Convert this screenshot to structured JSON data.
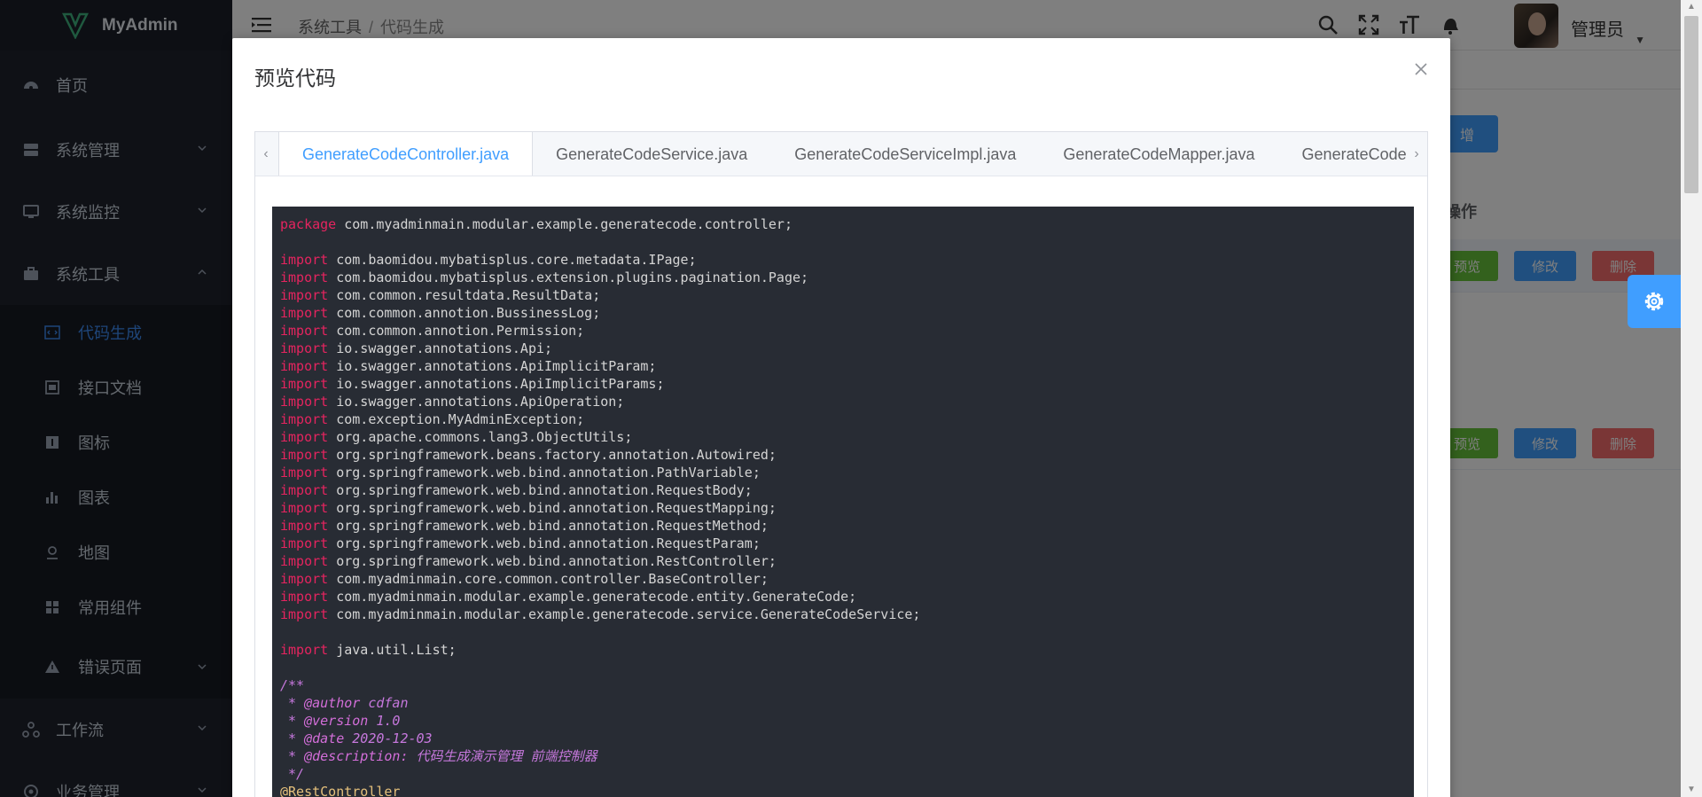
{
  "app": {
    "name": "MyAdmin"
  },
  "sidebar": {
    "items": [
      {
        "label": "首页",
        "icon": "dashboard-icon"
      },
      {
        "label": "系统管理",
        "icon": "server-icon"
      },
      {
        "label": "系统监控",
        "icon": "monitor-icon"
      },
      {
        "label": "系统工具",
        "icon": "toolbox-icon"
      }
    ],
    "sub_items": [
      {
        "label": "代码生成",
        "icon": "code-icon",
        "active": true
      },
      {
        "label": "接口文档",
        "icon": "doc-icon"
      },
      {
        "label": "图标",
        "icon": "info-icon"
      },
      {
        "label": "图表",
        "icon": "bar-chart-icon"
      },
      {
        "label": "地图",
        "icon": "map-pin-icon"
      },
      {
        "label": "常用组件",
        "icon": "grid-icon"
      },
      {
        "label": "错误页面",
        "icon": "warning-icon"
      }
    ],
    "bottom_items": [
      {
        "label": "工作流",
        "icon": "workflow-icon"
      },
      {
        "label": "业务管理",
        "icon": "business-icon"
      }
    ]
  },
  "header": {
    "breadcrumb": [
      "系统工具",
      "代码生成"
    ],
    "username": "管理员"
  },
  "background": {
    "table_header": "操作",
    "add_button": "增",
    "row_buttons": {
      "preview": "预览",
      "edit": "修改",
      "delete": "删除"
    }
  },
  "modal": {
    "title": "预览代码",
    "tabs": [
      "GenerateCodeController.java",
      "GenerateCodeService.java",
      "GenerateCodeServiceImpl.java",
      "GenerateCodeMapper.java",
      "GenerateCodeMap"
    ],
    "active_tab": 0
  },
  "code": {
    "lines": [
      [
        [
          "kw",
          "package"
        ],
        [
          "t",
          " com.myadminmain.modular.example.generatecode.controller;"
        ]
      ],
      [],
      [
        [
          "kw",
          "import"
        ],
        [
          "t",
          " com.baomidou.mybatisplus.core.metadata.IPage;"
        ]
      ],
      [
        [
          "kw",
          "import"
        ],
        [
          "t",
          " com.baomidou.mybatisplus.extension.plugins.pagination.Page;"
        ]
      ],
      [
        [
          "kw",
          "import"
        ],
        [
          "t",
          " com.common.resultdata.ResultData;"
        ]
      ],
      [
        [
          "kw",
          "import"
        ],
        [
          "t",
          " com.common.annotion.BussinessLog;"
        ]
      ],
      [
        [
          "kw",
          "import"
        ],
        [
          "t",
          " com.common.annotion.Permission;"
        ]
      ],
      [
        [
          "kw",
          "import"
        ],
        [
          "t",
          " io.swagger.annotations.Api;"
        ]
      ],
      [
        [
          "kw",
          "import"
        ],
        [
          "t",
          " io.swagger.annotations.ApiImplicitParam;"
        ]
      ],
      [
        [
          "kw",
          "import"
        ],
        [
          "t",
          " io.swagger.annotations.ApiImplicitParams;"
        ]
      ],
      [
        [
          "kw",
          "import"
        ],
        [
          "t",
          " io.swagger.annotations.ApiOperation;"
        ]
      ],
      [
        [
          "kw",
          "import"
        ],
        [
          "t",
          " com.exception.MyAdminException;"
        ]
      ],
      [
        [
          "kw",
          "import"
        ],
        [
          "t",
          " org.apache.commons.lang3.ObjectUtils;"
        ]
      ],
      [
        [
          "kw",
          "import"
        ],
        [
          "t",
          " org.springframework.beans.factory.annotation.Autowired;"
        ]
      ],
      [
        [
          "kw",
          "import"
        ],
        [
          "t",
          " org.springframework.web.bind.annotation.PathVariable;"
        ]
      ],
      [
        [
          "kw",
          "import"
        ],
        [
          "t",
          " org.springframework.web.bind.annotation.RequestBody;"
        ]
      ],
      [
        [
          "kw",
          "import"
        ],
        [
          "t",
          " org.springframework.web.bind.annotation.RequestMapping;"
        ]
      ],
      [
        [
          "kw",
          "import"
        ],
        [
          "t",
          " org.springframework.web.bind.annotation.RequestMethod;"
        ]
      ],
      [
        [
          "kw",
          "import"
        ],
        [
          "t",
          " org.springframework.web.bind.annotation.RequestParam;"
        ]
      ],
      [
        [
          "kw",
          "import"
        ],
        [
          "t",
          " org.springframework.web.bind.annotation.RestController;"
        ]
      ],
      [
        [
          "kw",
          "import"
        ],
        [
          "t",
          " com.myadminmain.core.common.controller.BaseController;"
        ]
      ],
      [
        [
          "kw",
          "import"
        ],
        [
          "t",
          " com.myadminmain.modular.example.generatecode.entity.GenerateCode;"
        ]
      ],
      [
        [
          "kw",
          "import"
        ],
        [
          "t",
          " com.myadminmain.modular.example.generatecode.service.GenerateCodeService;"
        ]
      ],
      [],
      [
        [
          "kw",
          "import"
        ],
        [
          "t",
          " java.util.List;"
        ]
      ],
      [],
      [
        [
          "cm",
          "/**"
        ]
      ],
      [
        [
          "cm",
          " * "
        ],
        [
          "cm-tag",
          "@author"
        ],
        [
          "cm",
          " cdfan"
        ]
      ],
      [
        [
          "cm",
          " * "
        ],
        [
          "cm-tag",
          "@version"
        ],
        [
          "cm",
          " 1.0"
        ]
      ],
      [
        [
          "cm",
          " * "
        ],
        [
          "cm-tag",
          "@date"
        ],
        [
          "cm",
          " 2020-12-03"
        ]
      ],
      [
        [
          "cm",
          " * "
        ],
        [
          "cm-tag",
          "@description:"
        ],
        [
          "cm",
          " 代码生成演示管理 前端控制器"
        ]
      ],
      [
        [
          "cm",
          " */"
        ]
      ],
      [
        [
          "ann",
          "@RestController"
        ]
      ]
    ]
  }
}
